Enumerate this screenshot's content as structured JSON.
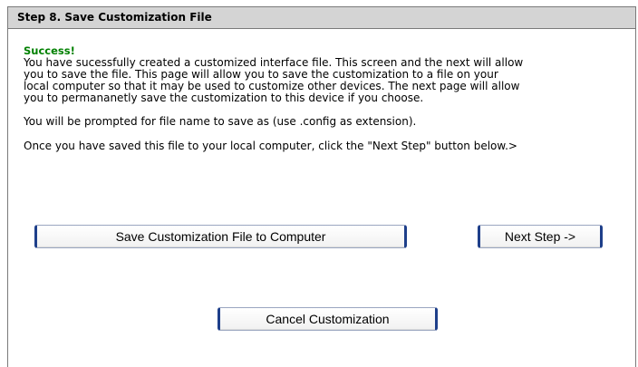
{
  "panel": {
    "title": "Step 8. Save Customization File"
  },
  "message": {
    "success_title": "Success!",
    "lines": [
      "You have sucessfully created a customized interface file. This screen and the next will allow",
      "you to save the file. This page will allow you to save the customization to a file on your",
      "local computer so that it may be used to customize other devices. The next page will allow",
      "you to permananetly save the customization to this device if you choose."
    ],
    "prompt_text": "You will be prompted for file name to save as (use .config as extension).",
    "instruction_text": "Once you have saved this file to your local computer, click the \"Next Step\" button below.>"
  },
  "buttons": {
    "save_label": "Save Customization File to Computer",
    "next_label": "Next Step ->",
    "cancel_label": "Cancel Customization"
  },
  "colors": {
    "header_bg": "#d4d4d4",
    "success_green": "#008000",
    "button_border": "#1e3f8a"
  }
}
